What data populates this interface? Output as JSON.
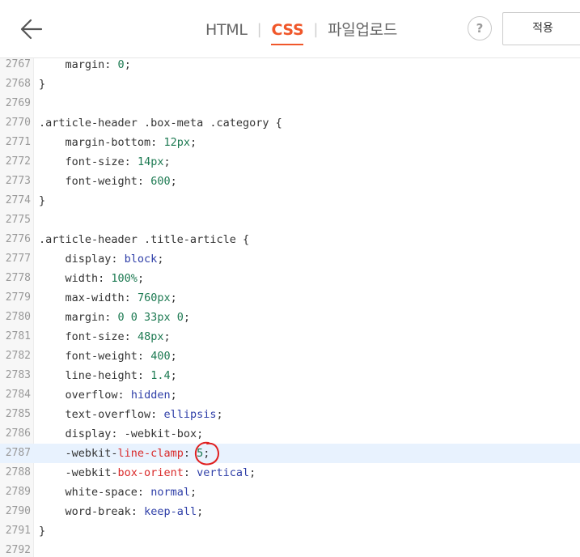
{
  "toolbar": {
    "tabs": [
      {
        "label": "HTML",
        "active": false
      },
      {
        "label": "CSS",
        "active": true
      },
      {
        "label": "파일업로드",
        "active": false
      }
    ],
    "help_label": "?",
    "apply_label": "적용",
    "accent_color": "#f0572a"
  },
  "editor": {
    "highlighted_line": "2787",
    "lines": [
      {
        "n": "2767",
        "code": [
          {
            "t": "    margin",
            "c": "prop"
          },
          {
            "t": ": ",
            "c": "punct"
          },
          {
            "t": "0",
            "c": "val-num"
          },
          {
            "t": ";",
            "c": "punct"
          }
        ]
      },
      {
        "n": "2768",
        "code": [
          {
            "t": "}",
            "c": "punct"
          }
        ]
      },
      {
        "n": "2769",
        "code": []
      },
      {
        "n": "2770",
        "code": [
          {
            "t": ".article-header .box-meta .category {",
            "c": "sel"
          }
        ]
      },
      {
        "n": "2771",
        "code": [
          {
            "t": "    margin-bottom",
            "c": "prop"
          },
          {
            "t": ": ",
            "c": "punct"
          },
          {
            "t": "12px",
            "c": "val-num"
          },
          {
            "t": ";",
            "c": "punct"
          }
        ]
      },
      {
        "n": "2772",
        "code": [
          {
            "t": "    font-size",
            "c": "prop"
          },
          {
            "t": ": ",
            "c": "punct"
          },
          {
            "t": "14px",
            "c": "val-num"
          },
          {
            "t": ";",
            "c": "punct"
          }
        ]
      },
      {
        "n": "2773",
        "code": [
          {
            "t": "    font-weight",
            "c": "prop"
          },
          {
            "t": ": ",
            "c": "punct"
          },
          {
            "t": "600",
            "c": "val-num"
          },
          {
            "t": ";",
            "c": "punct"
          }
        ]
      },
      {
        "n": "2774",
        "code": [
          {
            "t": "}",
            "c": "punct"
          }
        ]
      },
      {
        "n": "2775",
        "code": []
      },
      {
        "n": "2776",
        "code": [
          {
            "t": ".article-header .title-article {",
            "c": "sel"
          }
        ]
      },
      {
        "n": "2777",
        "code": [
          {
            "t": "    display",
            "c": "prop"
          },
          {
            "t": ": ",
            "c": "punct"
          },
          {
            "t": "block",
            "c": "val-kw"
          },
          {
            "t": ";",
            "c": "punct"
          }
        ]
      },
      {
        "n": "2778",
        "code": [
          {
            "t": "    width",
            "c": "prop"
          },
          {
            "t": ": ",
            "c": "punct"
          },
          {
            "t": "100%",
            "c": "val-num"
          },
          {
            "t": ";",
            "c": "punct"
          }
        ]
      },
      {
        "n": "2779",
        "code": [
          {
            "t": "    max-width",
            "c": "prop"
          },
          {
            "t": ": ",
            "c": "punct"
          },
          {
            "t": "760px",
            "c": "val-num"
          },
          {
            "t": ";",
            "c": "punct"
          }
        ]
      },
      {
        "n": "2780",
        "code": [
          {
            "t": "    margin",
            "c": "prop"
          },
          {
            "t": ": ",
            "c": "punct"
          },
          {
            "t": "0 0 33px 0",
            "c": "val-num"
          },
          {
            "t": ";",
            "c": "punct"
          }
        ]
      },
      {
        "n": "2781",
        "code": [
          {
            "t": "    font-size",
            "c": "prop"
          },
          {
            "t": ": ",
            "c": "punct"
          },
          {
            "t": "48px",
            "c": "val-num"
          },
          {
            "t": ";",
            "c": "punct"
          }
        ]
      },
      {
        "n": "2782",
        "code": [
          {
            "t": "    font-weight",
            "c": "prop"
          },
          {
            "t": ": ",
            "c": "punct"
          },
          {
            "t": "400",
            "c": "val-num"
          },
          {
            "t": ";",
            "c": "punct"
          }
        ]
      },
      {
        "n": "2783",
        "code": [
          {
            "t": "    line-height",
            "c": "prop"
          },
          {
            "t": ": ",
            "c": "punct"
          },
          {
            "t": "1.4",
            "c": "val-num"
          },
          {
            "t": ";",
            "c": "punct"
          }
        ]
      },
      {
        "n": "2784",
        "code": [
          {
            "t": "    overflow",
            "c": "prop"
          },
          {
            "t": ": ",
            "c": "punct"
          },
          {
            "t": "hidden",
            "c": "val-kw"
          },
          {
            "t": ";",
            "c": "punct"
          }
        ]
      },
      {
        "n": "2785",
        "code": [
          {
            "t": "    text-overflow",
            "c": "prop"
          },
          {
            "t": ": ",
            "c": "punct"
          },
          {
            "t": "ellipsis",
            "c": "val-kw"
          },
          {
            "t": ";",
            "c": "punct"
          }
        ]
      },
      {
        "n": "2786",
        "code": [
          {
            "t": "    display",
            "c": "prop"
          },
          {
            "t": ": ",
            "c": "punct"
          },
          {
            "t": "-webkit-box",
            "c": "punct"
          },
          {
            "t": ";",
            "c": "punct"
          }
        ]
      },
      {
        "n": "2787",
        "code": [
          {
            "t": "    -webkit-",
            "c": "punct"
          },
          {
            "t": "line-clamp",
            "c": "prop-red"
          },
          {
            "t": ": ",
            "c": "punct"
          },
          {
            "t": "5",
            "c": "val-num"
          },
          {
            "t": ";",
            "c": "punct"
          }
        ]
      },
      {
        "n": "2788",
        "code": [
          {
            "t": "    -webkit-",
            "c": "punct"
          },
          {
            "t": "box-orient",
            "c": "prop-red"
          },
          {
            "t": ": ",
            "c": "punct"
          },
          {
            "t": "vertical",
            "c": "val-kw"
          },
          {
            "t": ";",
            "c": "punct"
          }
        ]
      },
      {
        "n": "2789",
        "code": [
          {
            "t": "    white-space",
            "c": "prop"
          },
          {
            "t": ": ",
            "c": "punct"
          },
          {
            "t": "normal",
            "c": "val-kw"
          },
          {
            "t": ";",
            "c": "punct"
          }
        ]
      },
      {
        "n": "2790",
        "code": [
          {
            "t": "    word-break",
            "c": "prop"
          },
          {
            "t": ": ",
            "c": "punct"
          },
          {
            "t": "keep-all",
            "c": "val-kw"
          },
          {
            "t": ";",
            "c": "punct"
          }
        ]
      },
      {
        "n": "2791",
        "code": [
          {
            "t": "}",
            "c": "punct"
          }
        ]
      },
      {
        "n": "2792",
        "code": []
      }
    ]
  }
}
